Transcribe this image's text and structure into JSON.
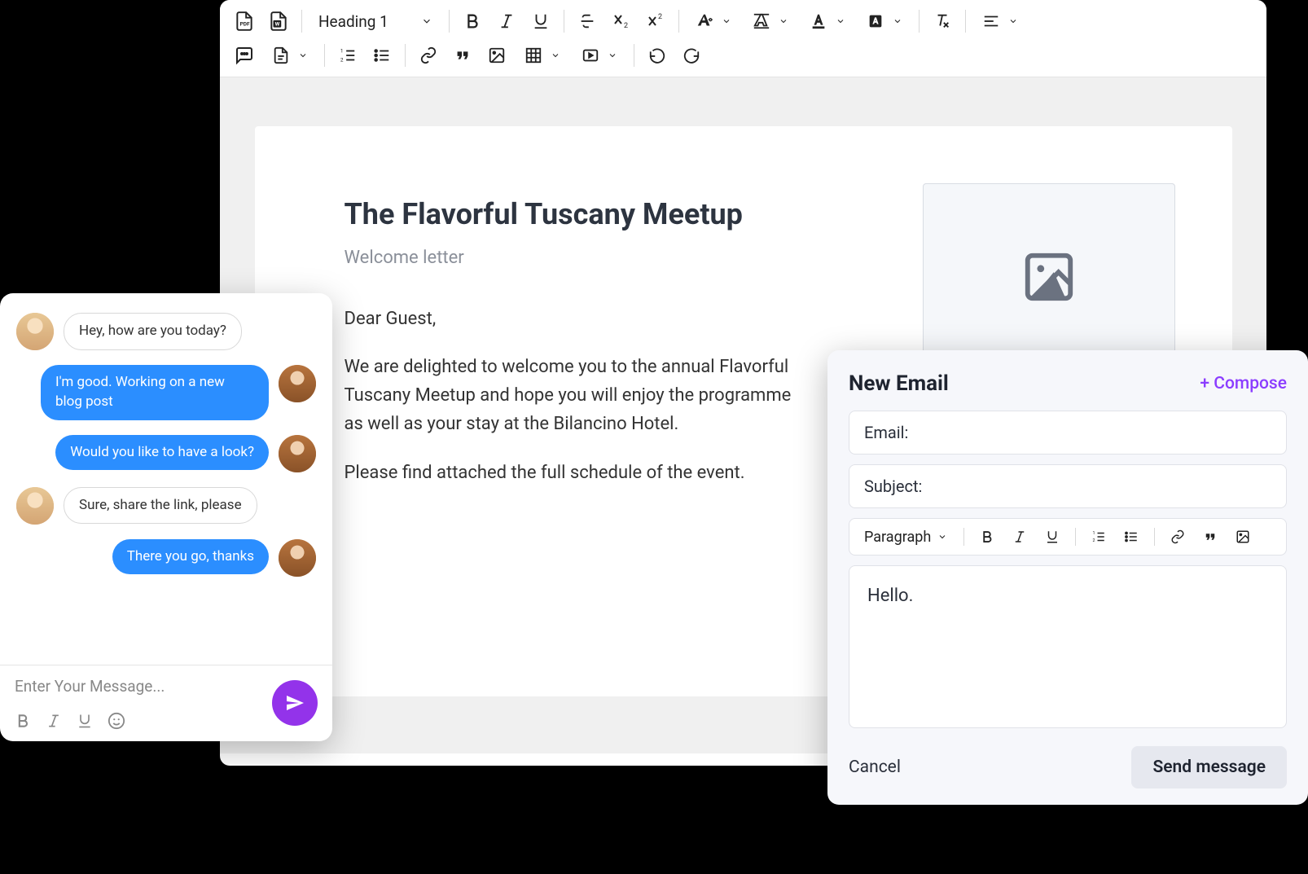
{
  "editor": {
    "heading_select": "Heading 1",
    "document": {
      "title": "The Flavorful Tuscany Meetup",
      "subtitle": "Welcome letter",
      "greeting": "Dear Guest,",
      "p1": "We are delighted to welcome you to the annual Flavorful Tuscany Meetup and hope you will enjoy the programme as well as your stay at the Bilancino Hotel.",
      "p2": "Please find attached the full schedule of the event."
    }
  },
  "chat": {
    "messages": [
      {
        "side": "left",
        "text": "Hey, how are you today?"
      },
      {
        "side": "right",
        "text": "I'm good. Working on a new blog post"
      },
      {
        "side": "right",
        "text": "Would you like to have a look?"
      },
      {
        "side": "left",
        "text": "Sure, share the link, please"
      },
      {
        "side": "right",
        "text": "There you go, thanks"
      }
    ],
    "input_placeholder": "Enter Your Message..."
  },
  "email": {
    "title": "New Email",
    "compose": "+ Compose",
    "email_label": "Email:",
    "subject_label": "Subject:",
    "style_select": "Paragraph",
    "body": "Hello.",
    "cancel": "Cancel",
    "send": "Send message"
  }
}
